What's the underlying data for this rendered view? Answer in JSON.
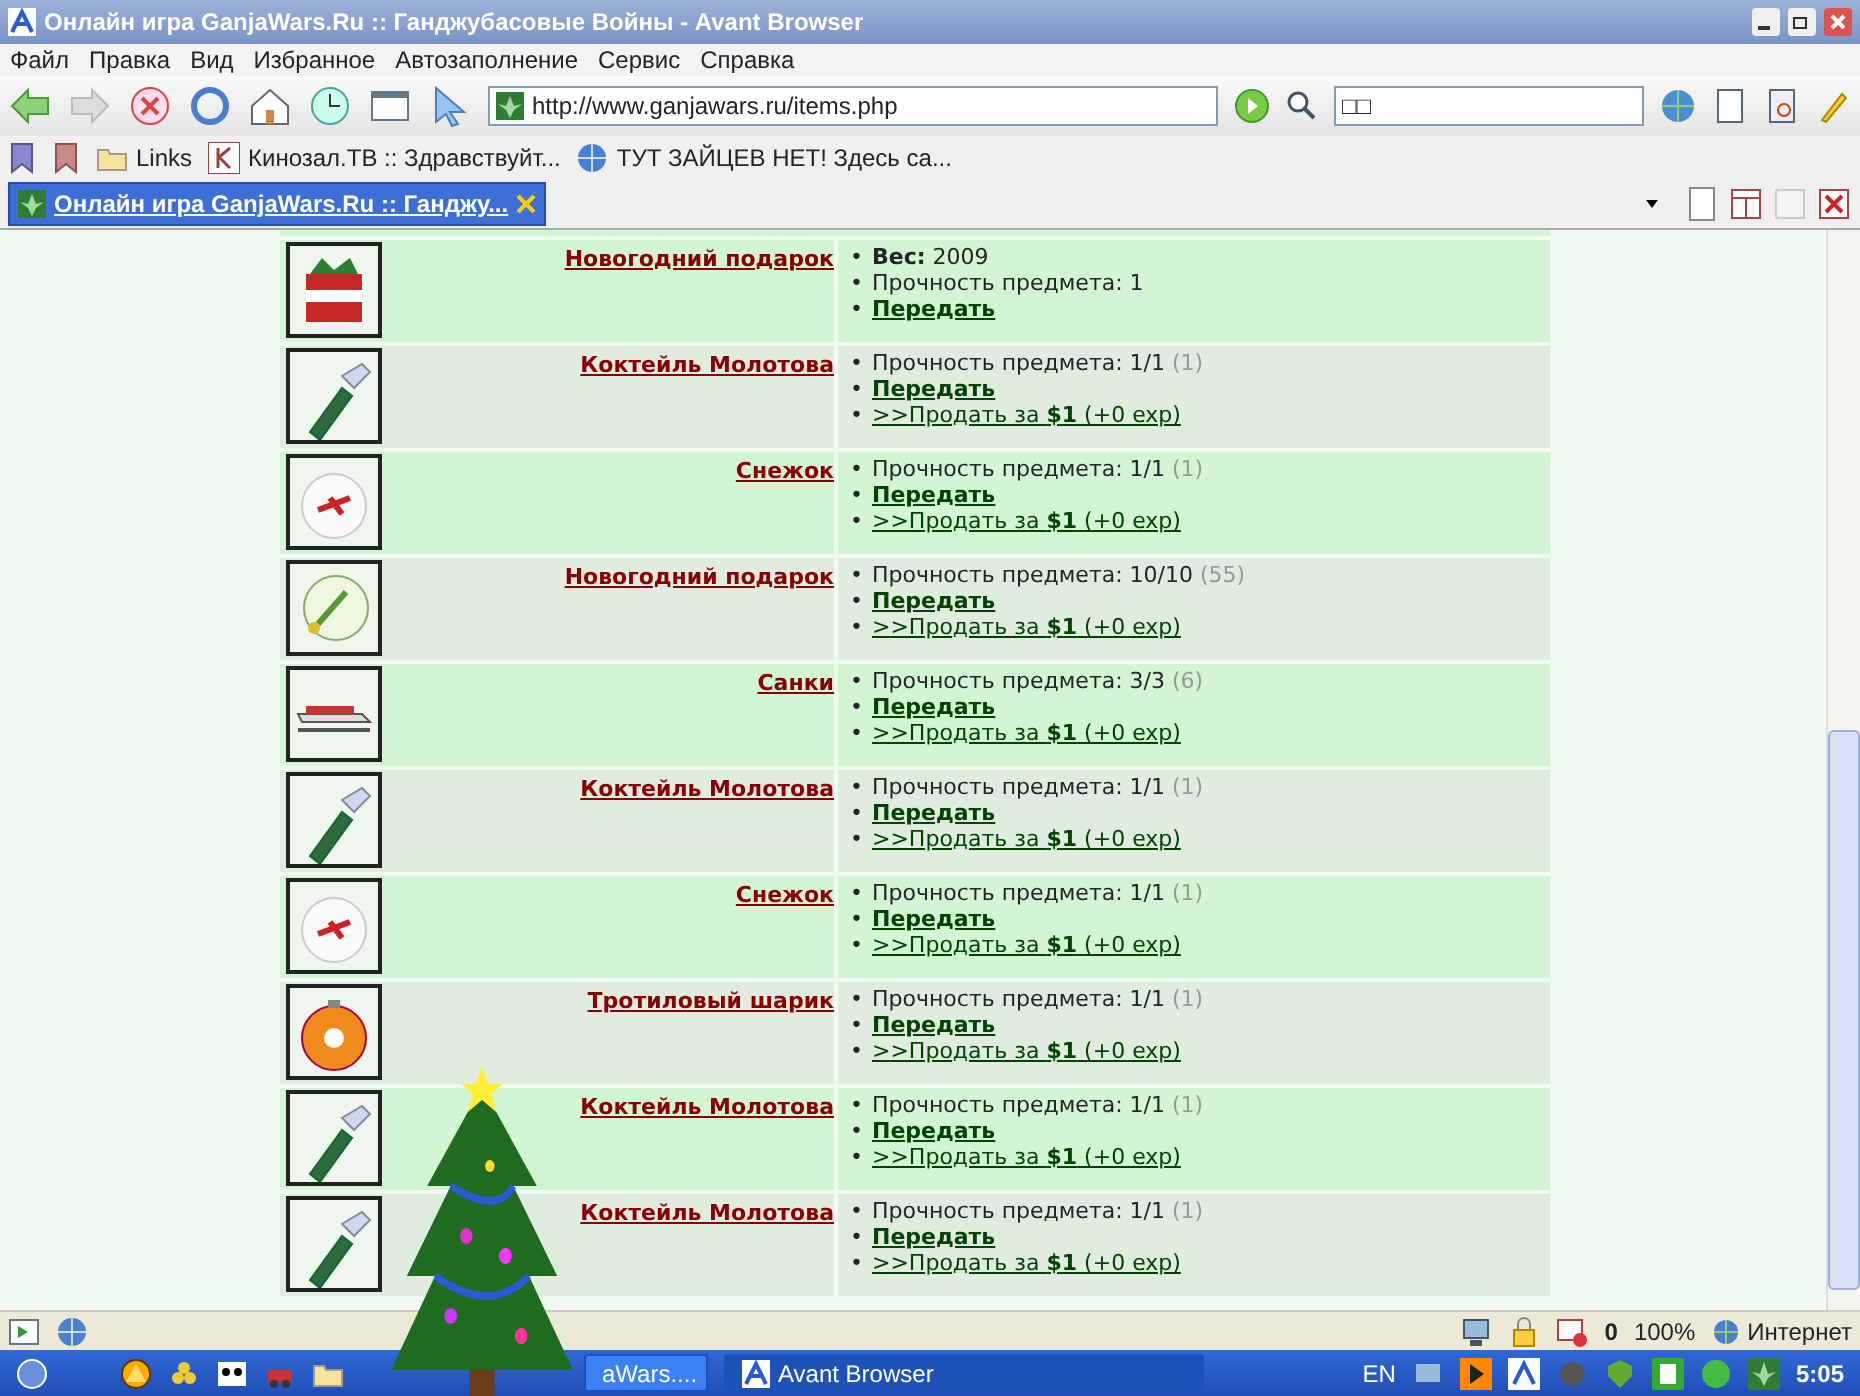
{
  "window": {
    "title": "Онлайн игра GanjaWars.Ru :: Ганджубасовые Войны - Avant Browser"
  },
  "menu": [
    "Файл",
    "Правка",
    "Вид",
    "Избранное",
    "Автозаполнение",
    "Сервис",
    "Справка"
  ],
  "address": {
    "value": "http://www.ganjawars.ru/items.php"
  },
  "search": {
    "value": "□□"
  },
  "links": [
    {
      "label": "Links",
      "kind": "folder"
    },
    {
      "label": "Кинозал.ТВ :: Здравствуйт...",
      "kind": "site"
    },
    {
      "label": "ТУТ ЗАЙЦЕВ НЕТ! Здесь са...",
      "kind": "globe"
    }
  ],
  "tabs": [
    {
      "label": "Онлайн игра GanjaWars.Ru :: Ганджу...",
      "selected": true
    }
  ],
  "items": [
    {
      "name": "Новогодний подарок",
      "kind": "gift",
      "details": [
        {
          "kind": "weight",
          "bullet": "•",
          "label": "Вес:",
          "value": "2009"
        },
        {
          "kind": "durability",
          "bullet": "•",
          "text": "Прочность предмета: 1"
        },
        {
          "kind": "transfer",
          "bullet": "•",
          "text": "Передать"
        }
      ]
    },
    {
      "name": "Коктейль Молотова",
      "kind": "bottle",
      "details": [
        {
          "kind": "durability",
          "bullet": "•",
          "text": "Прочность предмета: 1/1",
          "extra": "(1)"
        },
        {
          "kind": "transfer",
          "bullet": "•",
          "text": "Передать"
        },
        {
          "kind": "sell",
          "bullet": "•",
          "text": ">>Продать за **$1** (+0 exp)"
        }
      ]
    },
    {
      "name": "Снежок",
      "kind": "snowball",
      "details": [
        {
          "kind": "durability",
          "bullet": "•",
          "text": "Прочность предмета: 1/1",
          "extra": "(1)"
        },
        {
          "kind": "transfer",
          "bullet": "•",
          "text": "Передать"
        },
        {
          "kind": "sell",
          "bullet": "•",
          "text": ">>Продать за **$1** (+0 exp)"
        }
      ]
    },
    {
      "name": "Новогодний подарок",
      "kind": "ornament",
      "details": [
        {
          "kind": "durability",
          "bullet": "•",
          "text": "Прочность предмета: 10/10",
          "extra": "(55)"
        },
        {
          "kind": "transfer",
          "bullet": "•",
          "text": "Передать"
        },
        {
          "kind": "sell",
          "bullet": "•",
          "text": ">>Продать за **$1** (+0 exp)"
        }
      ]
    },
    {
      "name": "Санки",
      "kind": "sled",
      "details": [
        {
          "kind": "durability",
          "bullet": "•",
          "text": "Прочность предмета: 3/3",
          "extra": "(6)"
        },
        {
          "kind": "transfer",
          "bullet": "•",
          "text": "Передать"
        },
        {
          "kind": "sell",
          "bullet": "•",
          "text": ">>Продать за **$1** (+0 exp)"
        }
      ]
    },
    {
      "name": "Коктейль Молотова",
      "kind": "bottle",
      "details": [
        {
          "kind": "durability",
          "bullet": "•",
          "text": "Прочность предмета: 1/1",
          "extra": "(1)"
        },
        {
          "kind": "transfer",
          "bullet": "•",
          "text": "Передать"
        },
        {
          "kind": "sell",
          "bullet": "•",
          "text": ">>Продать за **$1** (+0 exp)"
        }
      ]
    },
    {
      "name": "Снежок",
      "kind": "snowball",
      "details": [
        {
          "kind": "durability",
          "bullet": "•",
          "text": "Прочность предмета: 1/1",
          "extra": "(1)"
        },
        {
          "kind": "transfer",
          "bullet": "•",
          "text": "Передать"
        },
        {
          "kind": "sell",
          "bullet": "•",
          "text": ">>Продать за **$1** (+0 exp)"
        }
      ]
    },
    {
      "name": "Тротиловый шарик",
      "kind": "ball",
      "details": [
        {
          "kind": "durability",
          "bullet": "•",
          "text": "Прочность предмета: 1/1",
          "extra": "(1)"
        },
        {
          "kind": "transfer",
          "bullet": "•",
          "text": "Передать"
        },
        {
          "kind": "sell",
          "bullet": "•",
          "text": ">>Продать за **$1** (+0 exp)"
        }
      ]
    },
    {
      "name": "Коктейль Молотова",
      "kind": "bottle",
      "details": [
        {
          "kind": "durability",
          "bullet": "•",
          "text": "Прочность предмета: 1/1",
          "extra": "(1)"
        },
        {
          "kind": "transfer",
          "bullet": "•",
          "text": "Передать"
        },
        {
          "kind": "sell",
          "bullet": "•",
          "text": ">>Продать за **$1** (+0 exp)"
        }
      ]
    },
    {
      "name": "Коктейль Молотова",
      "kind": "bottle",
      "details": [
        {
          "kind": "durability",
          "bullet": "•",
          "text": "Прочность предмета: 1/1",
          "extra": "(1)"
        },
        {
          "kind": "transfer",
          "bullet": "•",
          "text": "Передать"
        },
        {
          "kind": "sell",
          "bullet": "•",
          "text": ">>Продать за **$1** (+0 exp)"
        }
      ]
    }
  ],
  "status_bar": {
    "popups": "0",
    "zoom": "100%",
    "zone": "Интернет"
  },
  "taskbar": {
    "buttons": [
      {
        "label": "aWars....",
        "selected": false
      },
      {
        "label": "Avant Browser",
        "selected": true
      }
    ],
    "language": "EN",
    "clock": "5:05"
  }
}
